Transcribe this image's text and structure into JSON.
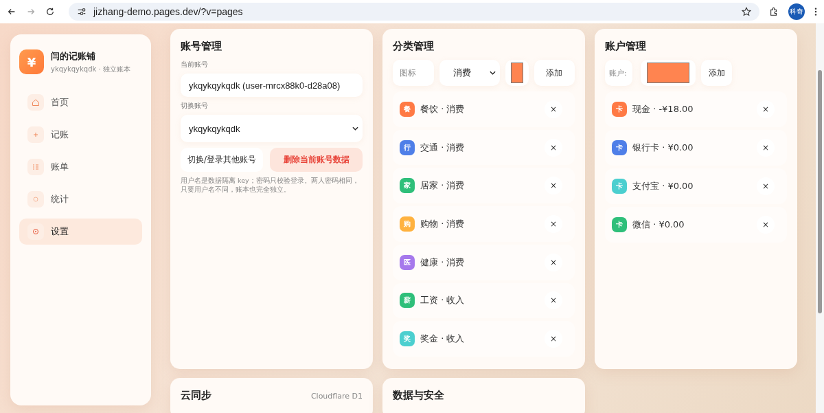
{
  "browser": {
    "url": "jizhang-demo.pages.dev/?v=pages",
    "profile": "科奇"
  },
  "brand": {
    "logo": "¥",
    "name": "闫的记账铺",
    "subtitle": "ykqykqykqdk · 独立账本"
  },
  "nav": [
    {
      "label": "首页",
      "kind": "home",
      "selected": false
    },
    {
      "label": "记账",
      "kind": "add",
      "selected": false
    },
    {
      "label": "账单",
      "kind": "bills",
      "selected": false
    },
    {
      "label": "统计",
      "kind": "stats",
      "selected": false
    },
    {
      "label": "设置",
      "kind": "settings",
      "selected": true
    }
  ],
  "account_card": {
    "title": "账号管理",
    "current_label": "当前账号",
    "current_value": "ykqykqykqdk (user-mrcx88k0-d28a08)",
    "switch_label": "切换账号",
    "switch_value": "ykqykqykqdk",
    "switch_button": "切换/登录其他账号",
    "delete_button": "删除当前账号数据",
    "note": "用户名是数据隔离 key；密码只校验登录。两人密码相同，只要用户名不同，账本也完全独立。"
  },
  "category_card": {
    "title": "分类管理",
    "icon_placeholder": "图标",
    "type_value": "消费",
    "add_button": "添加",
    "items": [
      {
        "badge": "餐",
        "label": "餐饮 · 消费",
        "color": "#ff7a45",
        "remove": "×"
      },
      {
        "badge": "行",
        "label": "交通 · 消费",
        "color": "#4f7fe8",
        "remove": "×"
      },
      {
        "badge": "家",
        "label": "居家 · 消费",
        "color": "#2fbf7a",
        "remove": "×"
      },
      {
        "badge": "购",
        "label": "购物 · 消费",
        "color": "#ffb23f",
        "remove": "×"
      },
      {
        "badge": "医",
        "label": "健康 · 消费",
        "color": "#a679ec",
        "remove": "×"
      },
      {
        "badge": "薪",
        "label": "工资 · 收入",
        "color": "#2fbf7a",
        "remove": "×"
      },
      {
        "badge": "奖",
        "label": "奖金 · 收入",
        "color": "#4ccfcf",
        "remove": "×"
      }
    ]
  },
  "wallet_card": {
    "title": "账户管理",
    "name_placeholder": "账户:",
    "add_button": "添加",
    "items": [
      {
        "badge": "卡",
        "label": "现金 · -¥18.00",
        "color": "#ff7a45",
        "remove": "×"
      },
      {
        "badge": "卡",
        "label": "银行卡 · ¥0.00",
        "color": "#4f7fe8",
        "remove": "×"
      },
      {
        "badge": "卡",
        "label": "支付宝 · ¥0.00",
        "color": "#4ccfcf",
        "remove": "×"
      },
      {
        "badge": "卡",
        "label": "微信 · ¥0.00",
        "color": "#2fbf7a",
        "remove": "×"
      }
    ]
  },
  "sync_card": {
    "title": "云同步",
    "provider": "Cloudflare D1"
  },
  "security_card": {
    "title": "数据与安全"
  }
}
